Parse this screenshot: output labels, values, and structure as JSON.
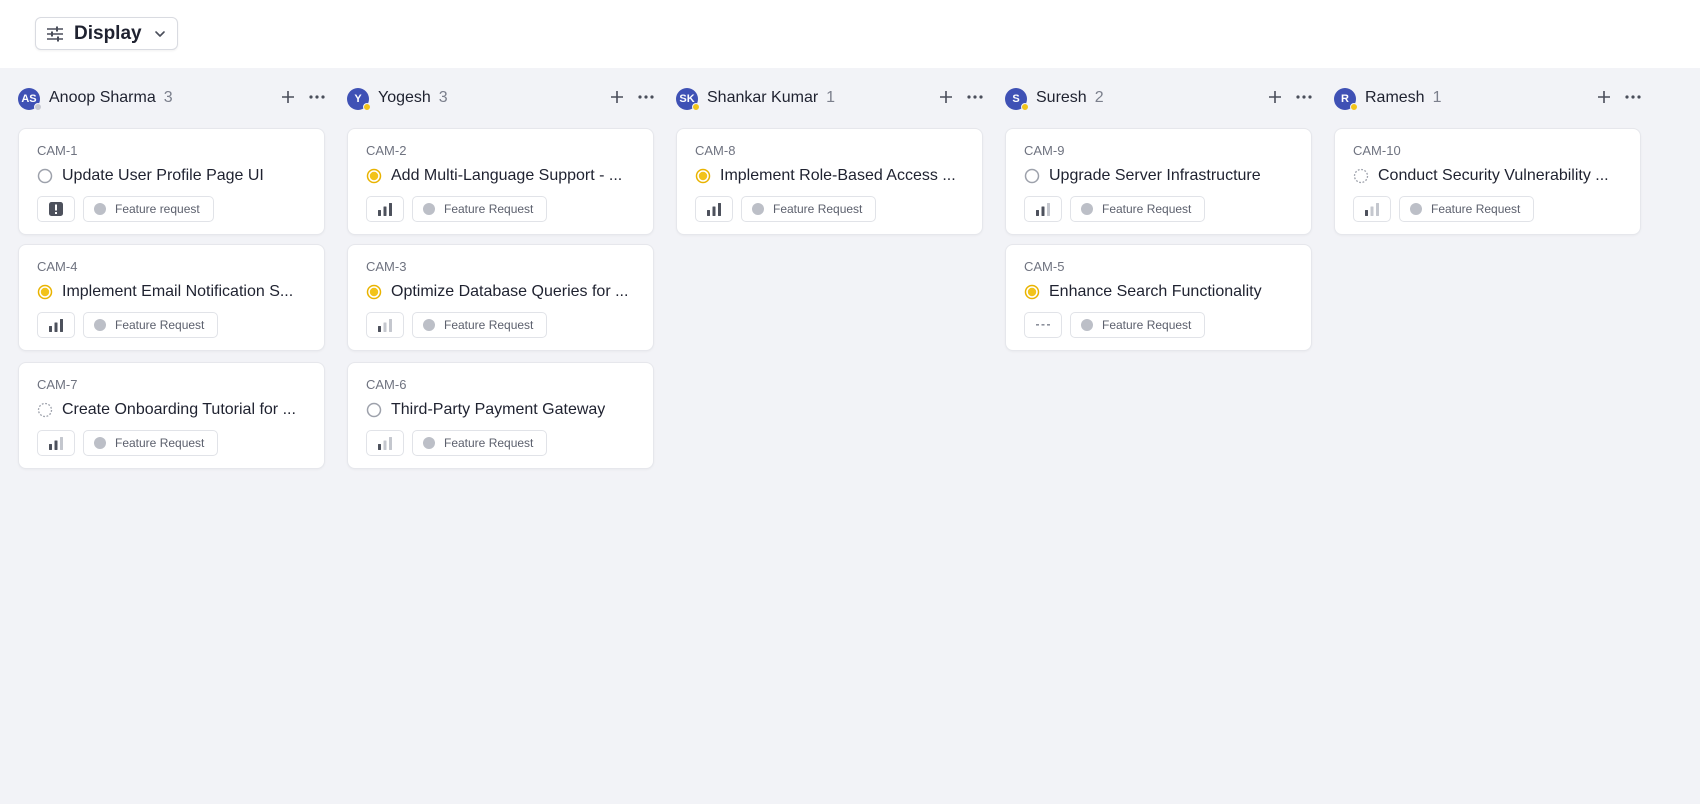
{
  "toolbar": {
    "display_label": "Display",
    "icon": "sliders-icon"
  },
  "columns": [
    {
      "initials": "AS",
      "name": "Anoop Sharma",
      "count": "3",
      "status_color": "#c7c9d1",
      "cards": [
        {
          "id": "CAM-1",
          "title": "Update User Profile Page UI",
          "status": "backlog",
          "priority": "urgent",
          "label": "Feature request"
        },
        {
          "id": "CAM-4",
          "title": "Implement Email Notification S...",
          "status": "in-progress",
          "priority": "high",
          "label": "Feature Request"
        },
        {
          "id": "CAM-7",
          "title": "Create Onboarding Tutorial for ...",
          "status": "todo",
          "priority": "medium",
          "label": "Feature Request"
        }
      ]
    },
    {
      "initials": "Y",
      "name": "Yogesh",
      "count": "3",
      "status_color": "#f2c31a",
      "cards": [
        {
          "id": "CAM-2",
          "title": "Add Multi-Language Support - ...",
          "status": "in-progress",
          "priority": "high",
          "label": "Feature Request"
        },
        {
          "id": "CAM-3",
          "title": "Optimize Database Queries for ...",
          "status": "in-progress",
          "priority": "low",
          "label": "Feature Request"
        },
        {
          "id": "CAM-6",
          "title": "Third-Party Payment Gateway",
          "status": "backlog",
          "priority": "low",
          "label": "Feature Request"
        }
      ]
    },
    {
      "initials": "SK",
      "name": "Shankar Kumar",
      "count": "1",
      "status_color": "#f2c31a",
      "cards": [
        {
          "id": "CAM-8",
          "title": "Implement Role-Based Access ...",
          "status": "in-progress",
          "priority": "high",
          "label": "Feature Request"
        }
      ]
    },
    {
      "initials": "S",
      "name": "Suresh",
      "count": "2",
      "status_color": "#f2c31a",
      "cards": [
        {
          "id": "CAM-9",
          "title": "Upgrade Server Infrastructure",
          "status": "backlog",
          "priority": "medium",
          "label": "Feature Request"
        },
        {
          "id": "CAM-5",
          "title": "Enhance Search Functionality",
          "status": "in-progress",
          "priority": "none",
          "label": "Feature Request"
        }
      ]
    },
    {
      "initials": "R",
      "name": "Ramesh",
      "count": "1",
      "status_color": "#f2c31a",
      "cards": [
        {
          "id": "CAM-10",
          "title": "Conduct Security Vulnerability ...",
          "status": "todo",
          "priority": "low",
          "label": "Feature Request"
        }
      ]
    }
  ]
}
